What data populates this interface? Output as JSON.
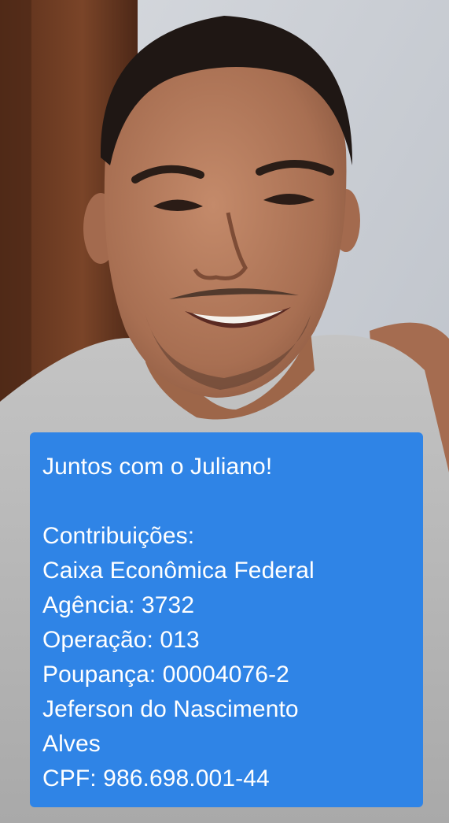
{
  "image": {
    "subject": "smiling man selfie",
    "colors": {
      "wall": "#c9cdd4",
      "door": "#6b3a22",
      "skin": "#b27a5c",
      "shirt": "#bdbdbd",
      "caption_bg": "#2f84e6"
    }
  },
  "caption": {
    "title": "Juntos com o Juliano!",
    "lines": [
      "Contribuições:",
      "Caixa Econômica Federal",
      "Agência: 3732",
      "Operação: 013",
      "Poupança: 00004076-2",
      "Jeferson do Nascimento",
      "Alves",
      "CPF: 986.698.001-44"
    ]
  }
}
